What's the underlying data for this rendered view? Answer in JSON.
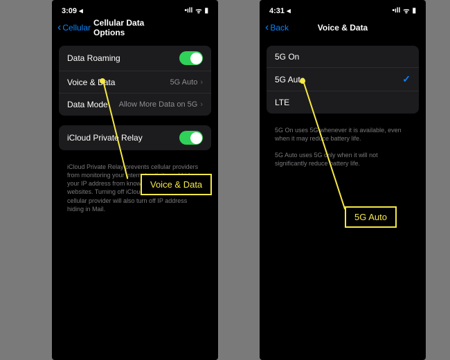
{
  "left": {
    "status": {
      "time": "3:09",
      "loc": "◂",
      "signal": "•ıll",
      "wifi": "ᯤ",
      "batt": "▮"
    },
    "back_label": "Cellular",
    "title": "Cellular Data Options",
    "group1": [
      {
        "label": "Data Roaming",
        "type": "toggle"
      },
      {
        "label": "Voice & Data",
        "value": "5G Auto",
        "type": "nav"
      },
      {
        "label": "Data Mode",
        "value": "Allow More Data on 5G",
        "type": "nav"
      }
    ],
    "group2": [
      {
        "label": "iCloud Private Relay",
        "type": "toggle"
      }
    ],
    "footer": "iCloud Private Relay prevents cellular providers from monitoring your internet activity and hides your IP address from known trackers and websites. Turning off iCloud Private Relay for this cellular provider will also turn off IP address hiding in Mail.",
    "callout": "Voice & Data"
  },
  "right": {
    "status": {
      "time": "4:31",
      "loc": "◂",
      "signal": "•ıll",
      "wifi": "ᯤ",
      "batt": "▮"
    },
    "back_label": "Back",
    "title": "Voice & Data",
    "options": [
      {
        "label": "5G On",
        "checked": false
      },
      {
        "label": "5G Auto",
        "checked": true
      },
      {
        "label": "LTE",
        "checked": false
      }
    ],
    "footer1": "5G On uses 5G whenever it is available, even when it may reduce battery life.",
    "footer2": "5G Auto uses 5G only when it will not significantly reduce battery life.",
    "callout": "5G Auto"
  }
}
